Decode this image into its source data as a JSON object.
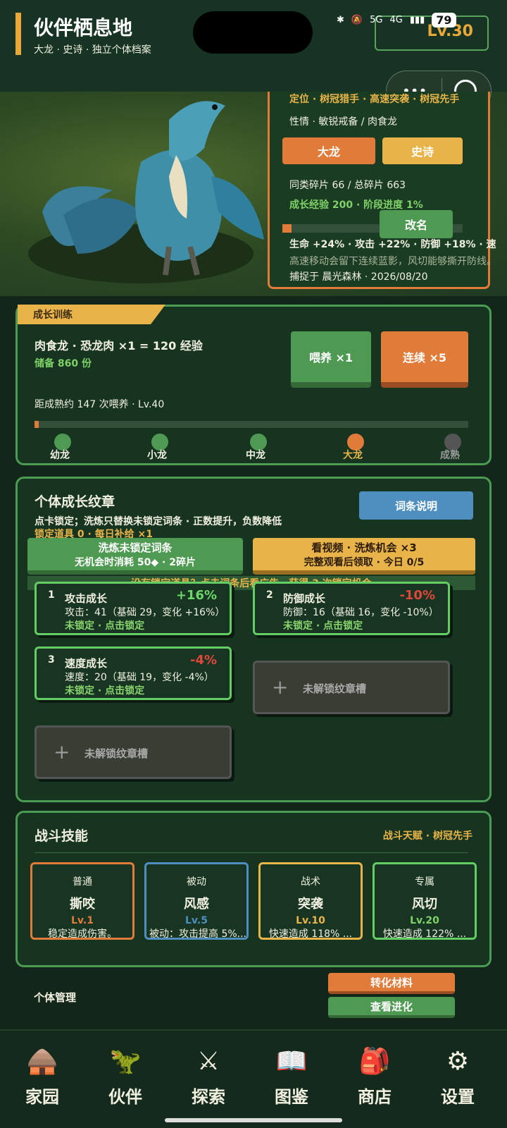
{
  "header": {
    "title": "伙伴栖息地",
    "subtitle": "大龙 · 史诗 · 独立个体档案",
    "level": "Lv.30"
  },
  "status_bar": {
    "net1": "5G",
    "net2": "4G",
    "battery": "79"
  },
  "info": {
    "role": "定位 · 树冠猎手 · 高速突袭 · 树冠先手",
    "temper": "性情 · 敏锐戒备 / 肉食龙",
    "tag_stage": "大龙",
    "tag_rarity": "史诗",
    "shards": "同类碎片 66 / 总碎片 663",
    "exp": "成长经验 200 · 阶段进度 1%",
    "rename": "改名",
    "stats": "生命 +24% · 攻击 +22% · 防御 +18% · 速",
    "desc": "高速移动会留下连续蓝影，风切能够撕开防线。",
    "caught": "捕捉于 晨光森林 · 2026/08/20",
    "exp_progress": 0.05
  },
  "training": {
    "tab": "成长训练",
    "feed_text": "肉食龙 · 恐龙肉 ×1 = 120 经验",
    "stock": "储备 860 份",
    "feed_btn": "喂养 ×1",
    "cont_btn": "连续 ×5",
    "remain": "距成熟约 147 次喂养 · Lv.40",
    "progress": 0.01,
    "stages": [
      "幼龙",
      "小龙",
      "中龙",
      "大龙",
      "成熟"
    ]
  },
  "pattern": {
    "title": "个体成长纹章",
    "help_btn": "词条说明",
    "line1": "点卡锁定；洗炼只替换未锁定词条 · 正数提升，负数降低",
    "line2": "锁定道具 0 · 每日补给 ×1",
    "wash_title": "洗炼未锁定词条",
    "wash_sub": "无机会时消耗 50◆ · 2碎片",
    "video_title": "看视频 · 洗炼机会 ×3",
    "video_sub": "完整观看后领取 · 今日 0/5",
    "banner": "没有锁定道具？点击词条后看广告，获得 3 次锁定机会",
    "cards": [
      {
        "num": "1",
        "name": "攻击成长",
        "pct": "+16%",
        "desc": "攻击：41（基础 29，变化 +16%）",
        "state": "未锁定 · 点击锁定"
      },
      {
        "num": "2",
        "name": "防御成长",
        "pct": "-10%",
        "desc": "防御：16（基础 16，变化 -10%）",
        "state": "未锁定 · 点击锁定"
      },
      {
        "num": "3",
        "name": "速度成长",
        "pct": "-4%",
        "desc": "速度：20（基础 19，变化 -4%）",
        "state": "未锁定 · 点击锁定"
      }
    ],
    "locked_slot": "未解锁纹章槽",
    "plus": "+"
  },
  "skills": {
    "title": "战斗技能",
    "talent": "战斗天赋 · 树冠先手",
    "items": [
      {
        "type": "普通",
        "name": "撕咬",
        "lv": "Lv.1",
        "desc": "稳定造成伤害。"
      },
      {
        "type": "被动",
        "name": "风感",
        "lv": "Lv.5",
        "desc": "被动：攻击提高 5%..."
      },
      {
        "type": "战术",
        "name": "突袭",
        "lv": "Lv.10",
        "desc": "快速造成 118% ..."
      },
      {
        "type": "专属",
        "name": "风切",
        "lv": "Lv.20",
        "desc": "快速造成 122% ..."
      }
    ]
  },
  "manage": {
    "label": "个体管理",
    "convert_btn": "转化材料",
    "evolve_btn": "查看进化"
  },
  "nav": {
    "items": [
      {
        "label": "家园",
        "icon": "hut-icon"
      },
      {
        "label": "伙伴",
        "icon": "claw-icon"
      },
      {
        "label": "探索",
        "icon": "crossed-swords-icon"
      },
      {
        "label": "图鉴",
        "icon": "book-icon"
      },
      {
        "label": "商店",
        "icon": "backpack-icon"
      },
      {
        "label": "设置",
        "icon": "gear-icon"
      }
    ]
  },
  "colors": {
    "accent_orange": "#e07b3a",
    "accent_gold": "#e8b44a",
    "accent_green": "#4f9a52",
    "negative": "#e0463a",
    "positive": "#6fd66b"
  }
}
